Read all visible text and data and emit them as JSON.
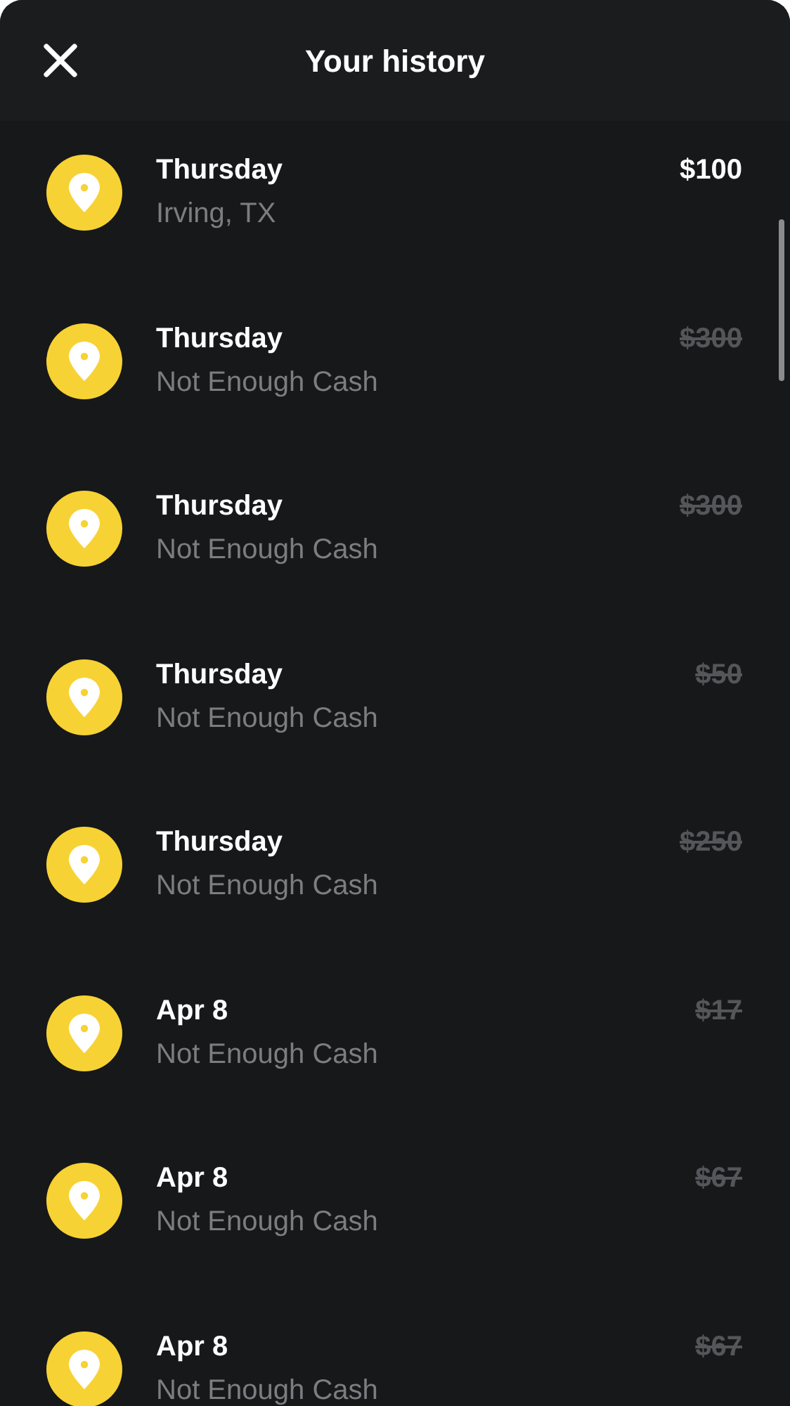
{
  "header": {
    "title": "Your history"
  },
  "items": [
    {
      "date": "Thursday",
      "detail": "Irving, TX",
      "amount": "$100",
      "declined": false
    },
    {
      "date": "Thursday",
      "detail": "Not Enough Cash",
      "amount": "$300",
      "declined": true
    },
    {
      "date": "Thursday",
      "detail": "Not Enough Cash",
      "amount": "$300",
      "declined": true
    },
    {
      "date": "Thursday",
      "detail": "Not Enough Cash",
      "amount": "$50",
      "declined": true
    },
    {
      "date": "Thursday",
      "detail": "Not Enough Cash",
      "amount": "$250",
      "declined": true
    },
    {
      "date": "Apr 8",
      "detail": "Not Enough Cash",
      "amount": "$17",
      "declined": true
    },
    {
      "date": "Apr 8",
      "detail": "Not Enough Cash",
      "amount": "$67",
      "declined": true
    },
    {
      "date": "Apr 8",
      "detail": "Not Enough Cash",
      "amount": "$67",
      "declined": true
    }
  ]
}
